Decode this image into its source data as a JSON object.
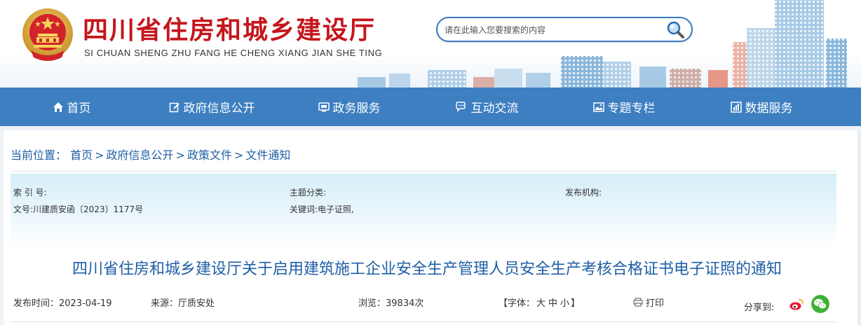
{
  "header": {
    "title": "四川省住房和城乡建设厅",
    "subtitle": "SI CHUAN SHENG ZHU FANG HE CHENG XIANG JIAN SHE TING",
    "search_placeholder": "请在此输入您要搜索的内容",
    "colors": {
      "title": "#c4161c",
      "nav_bg": "#3d7fc1",
      "link": "#1f5fa6"
    }
  },
  "nav": {
    "items": [
      {
        "label": "首页",
        "icon": "home-icon"
      },
      {
        "label": "政府信息公开",
        "icon": "edit-icon"
      },
      {
        "label": "政务服务",
        "icon": "monitor-icon"
      },
      {
        "label": "互动交流",
        "icon": "chat-icon"
      },
      {
        "label": "专题专栏",
        "icon": "image-icon"
      },
      {
        "label": "数据服务",
        "icon": "chart-icon"
      }
    ]
  },
  "breadcrumb": {
    "label": "当前位置：",
    "items": [
      "首页",
      "政府信息公开",
      "政策文件",
      "文件通知"
    ],
    "separator": ">"
  },
  "meta": {
    "index_label": "索 引 号:",
    "index_value": "",
    "topic_label": "主题分类:",
    "topic_value": "",
    "publisher_label": "发布机构:",
    "publisher_value": "",
    "doc_no_label": "文号:",
    "doc_no_value": "川建质安函〔2023〕1177号",
    "keywords_label": "关键词:",
    "keywords_value": "电子证照,"
  },
  "document": {
    "title": "四川省住房和城乡建设厅关于启用建筑施工企业安全生产管理人员安全生产考核合格证书电子证照的通知"
  },
  "info": {
    "date_label": "发布时间：",
    "date_value": "2023-04-19",
    "source_label": "来源：",
    "source_value": "厅质安处",
    "views_label": "浏览：",
    "views_value": "39834次",
    "font_label": "【字体：",
    "font_large": "大",
    "font_medium": "中",
    "font_small": "小",
    "font_close": "】",
    "print_label": "打印",
    "share_label": "分享到:",
    "share_targets": [
      "weibo-icon",
      "wechat-icon"
    ]
  }
}
